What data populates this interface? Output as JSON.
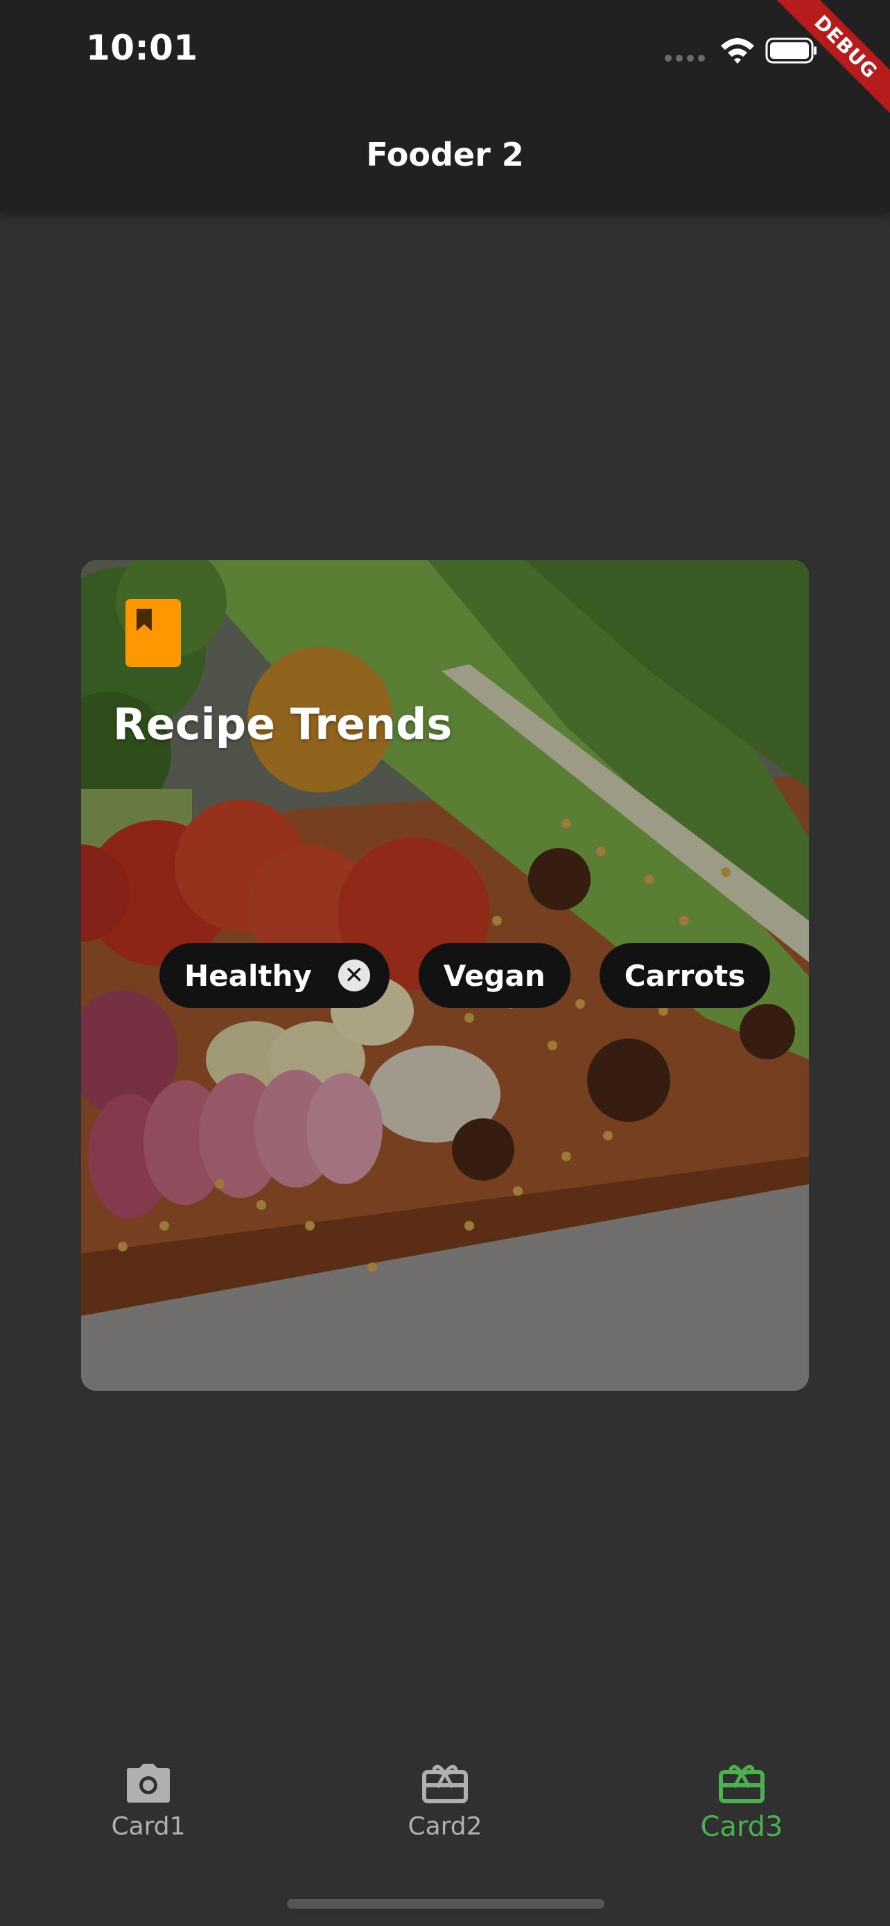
{
  "status_bar": {
    "time": "10:01"
  },
  "debug_banner": "DEBUG",
  "app_bar": {
    "title": "Fooder 2"
  },
  "card": {
    "title": "Recipe Trends",
    "icon": "book-icon",
    "icon_color": "#ff9800",
    "chips": [
      {
        "label": "Healthy",
        "removable": true
      },
      {
        "label": "Vegan",
        "removable": false
      },
      {
        "label": "Carrots",
        "removable": false
      }
    ]
  },
  "bottom_nav": {
    "items": [
      {
        "label": "Card1",
        "icon": "camera-icon",
        "active": false
      },
      {
        "label": "Card2",
        "icon": "card-giftcard-icon",
        "active": false
      },
      {
        "label": "Card3",
        "icon": "card-giftcard-icon",
        "active": true
      }
    ],
    "active_color": "#4caf50"
  }
}
